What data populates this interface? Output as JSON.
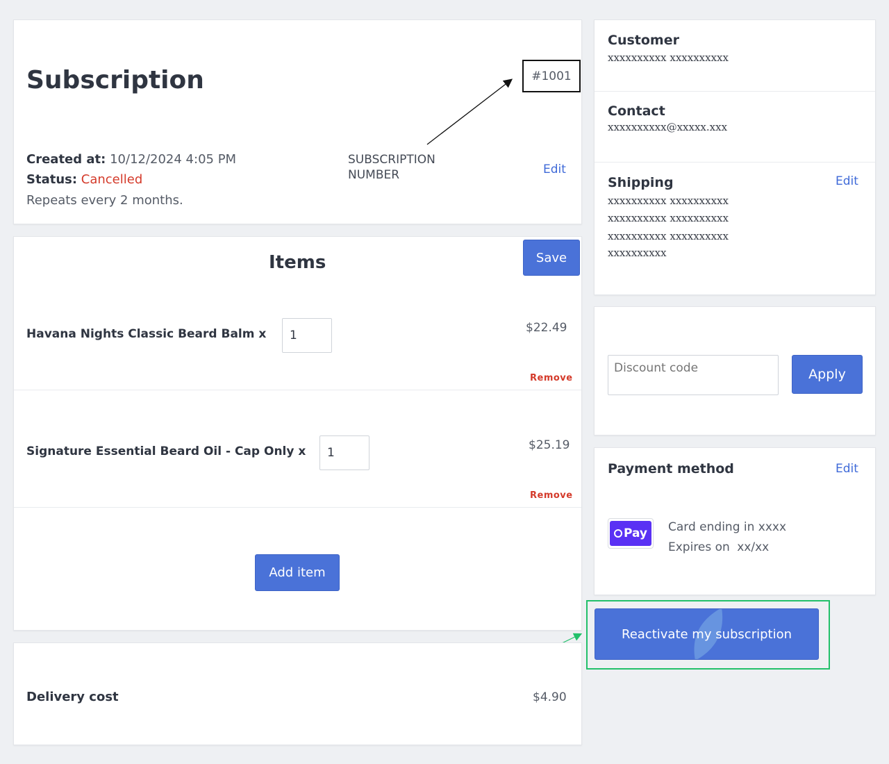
{
  "subscription": {
    "title": "Subscription",
    "number": "#1001",
    "annotation_label_line1": "SUBSCRIPTION",
    "annotation_label_line2": "NUMBER",
    "created_label": "Created at:",
    "created_value": "10/12/2024 4:05 PM",
    "status_label": "Status:",
    "status_value": "Cancelled",
    "repeat_text": "Repeats every 2 months.",
    "edit_label": "Edit"
  },
  "items": {
    "title": "Items",
    "save_label": "Save",
    "list": [
      {
        "name": "Havana Nights Classic Beard Balm x",
        "qty": "1",
        "price": "$22.49",
        "remove_label": "Remove"
      },
      {
        "name": "Signature Essential Beard Oil - Cap Only x",
        "qty": "1",
        "price": "$25.19",
        "remove_label": "Remove"
      }
    ],
    "add_item_label": "Add item"
  },
  "delivery": {
    "label": "Delivery cost",
    "value": "$4.90"
  },
  "customer": {
    "label": "Customer",
    "value": "xxxxxxxxxx xxxxxxxxxx"
  },
  "contact": {
    "label": "Contact",
    "value": "xxxxxxxxxx@xxxxx.xxx"
  },
  "shipping": {
    "label": "Shipping",
    "edit_label": "Edit",
    "lines": [
      "xxxxxxxxxx xxxxxxxxxx",
      "xxxxxxxxxx xxxxxxxxxx",
      "xxxxxxxxxx xxxxxxxxxx",
      "xxxxxxxxxx"
    ]
  },
  "discount": {
    "placeholder": "Discount code",
    "apply_label": "Apply"
  },
  "payment": {
    "label": "Payment method",
    "edit_label": "Edit",
    "brand": "Pay",
    "card_line": "Card ending in xxxx",
    "expires_label": "Expires on",
    "expires_value": "xx/xx"
  },
  "reactivate_label": "Reactivate my subscription",
  "colors": {
    "accent": "#4a72d8",
    "status_cancelled": "#d43a2a",
    "remove": "#d43a2a",
    "highlight_border": "#22c06a",
    "opay_purple": "#5a31f4",
    "background": "#eef0f3"
  }
}
